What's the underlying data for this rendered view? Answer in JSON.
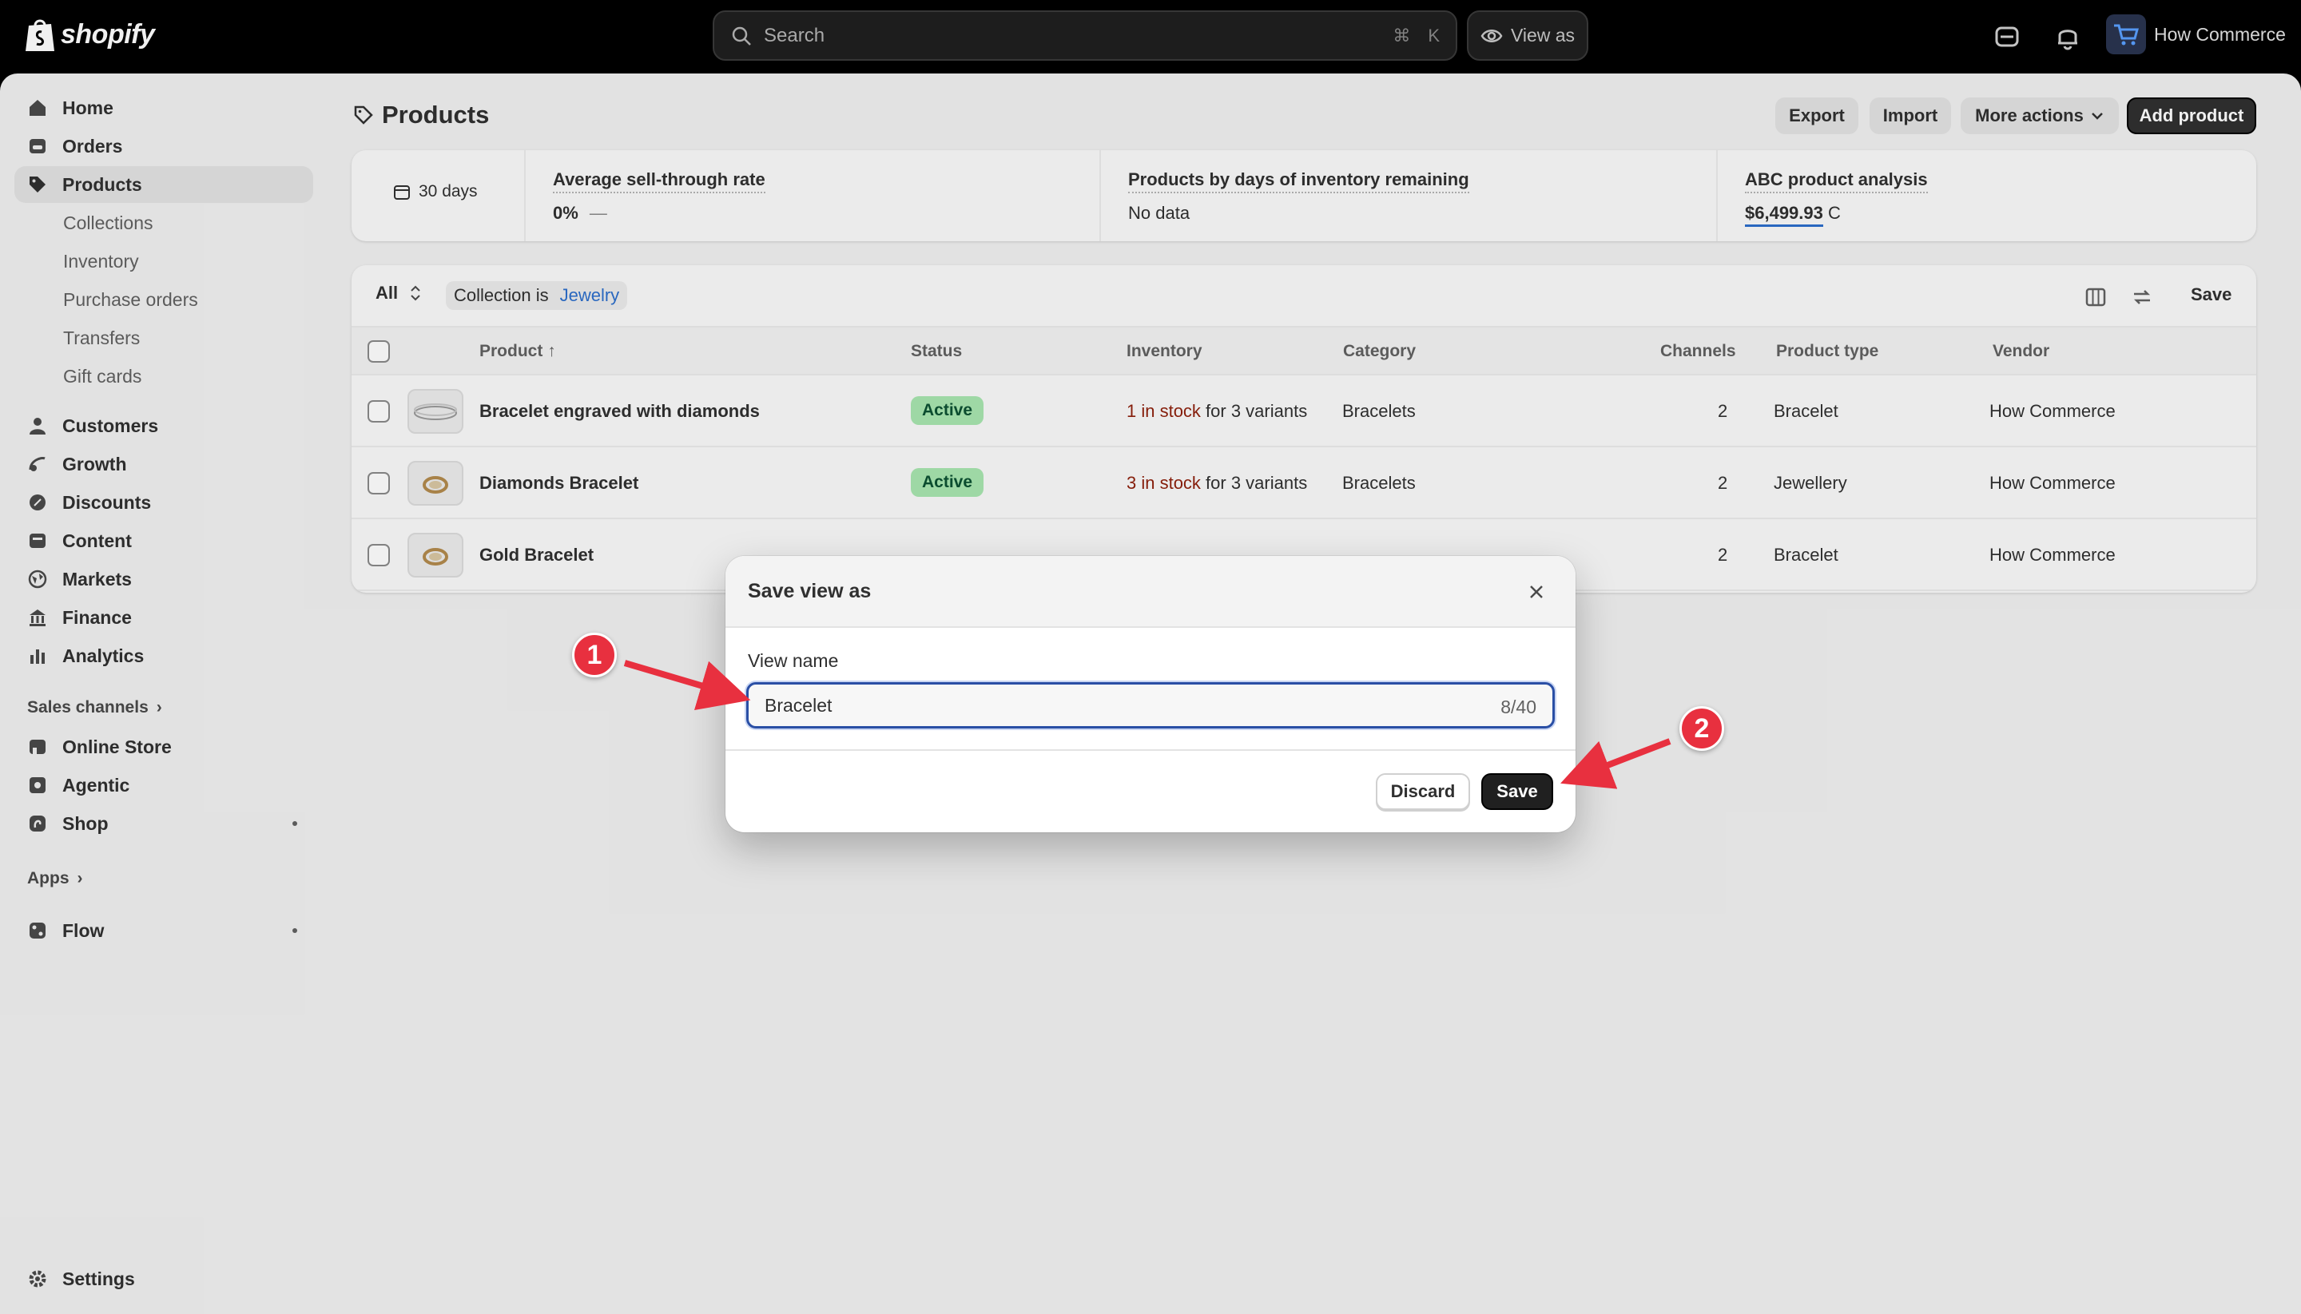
{
  "topbar": {
    "logo_text": "shopify",
    "search_placeholder": "Search",
    "search_shortcut_cmd": "⌘",
    "search_shortcut_key": "K",
    "view_as": "View as",
    "store_name": "How Commerce"
  },
  "sidebar": {
    "items": [
      {
        "label": "Home",
        "icon": "home-icon"
      },
      {
        "label": "Orders",
        "icon": "orders-icon"
      },
      {
        "label": "Products",
        "icon": "tag-icon",
        "active": true
      },
      {
        "label": "Customers",
        "icon": "person-icon"
      },
      {
        "label": "Growth",
        "icon": "growth-icon"
      },
      {
        "label": "Discounts",
        "icon": "discount-icon"
      },
      {
        "label": "Content",
        "icon": "content-icon"
      },
      {
        "label": "Markets",
        "icon": "globe-icon"
      },
      {
        "label": "Finance",
        "icon": "bank-icon"
      },
      {
        "label": "Analytics",
        "icon": "chart-icon"
      }
    ],
    "product_sub": [
      "Collections",
      "Inventory",
      "Purchase orders",
      "Transfers",
      "Gift cards"
    ],
    "sales_channels_label": "Sales channels",
    "channels": [
      {
        "label": "Online Store",
        "icon": "store-icon"
      },
      {
        "label": "Agentic",
        "icon": "agentic-icon"
      },
      {
        "label": "Shop",
        "icon": "shop-icon"
      }
    ],
    "apps_label": "Apps",
    "apps": [
      {
        "label": "Flow",
        "icon": "flow-icon"
      }
    ],
    "settings_label": "Settings"
  },
  "page": {
    "title": "Products",
    "export": "Export",
    "import": "Import",
    "more_actions": "More actions",
    "add_product": "Add product"
  },
  "stats": {
    "period": "30 days",
    "items": [
      {
        "label": "Average sell-through rate",
        "value": "0%",
        "trend": "—"
      },
      {
        "label": "Products by days of inventory remaining",
        "value": "No data"
      },
      {
        "label": "ABC product analysis",
        "value": "$6,499.93",
        "suffix": "C"
      }
    ]
  },
  "table": {
    "tab_all": "All",
    "filter_label": "Collection is",
    "filter_value": "Jewelry",
    "save": "Save",
    "columns": [
      "Product",
      "Status",
      "Inventory",
      "Category",
      "Channels",
      "Product type",
      "Vendor"
    ],
    "sort_arrow": "↑",
    "rows": [
      {
        "product": "Bracelet engraved with diamonds",
        "status": "Active",
        "stock": "1 in stock",
        "variants": " for 3 variants",
        "category": "Bracelets",
        "channels": "2",
        "type": "Bracelet",
        "vendor": "How Commerce"
      },
      {
        "product": "Diamonds Bracelet",
        "status": "Active",
        "stock": "3 in stock",
        "variants": " for 3 variants",
        "category": "Bracelets",
        "channels": "2",
        "type": "Jewellery",
        "vendor": "How Commerce"
      },
      {
        "product": "Gold Bracelet",
        "status": "",
        "stock": "",
        "variants": "",
        "category": "",
        "channels": "2",
        "type": "Bracelet",
        "vendor": "How Commerce"
      }
    ]
  },
  "modal": {
    "title": "Save view as",
    "field_label": "View name",
    "field_value": "Bracelet",
    "counter": "8/40",
    "discard": "Discard",
    "save": "Save"
  },
  "annotations": [
    "1",
    "2"
  ],
  "colors": {
    "accent_red": "#e8303f",
    "active_badge": "#a8e6b0",
    "primary_button": "#202020"
  }
}
